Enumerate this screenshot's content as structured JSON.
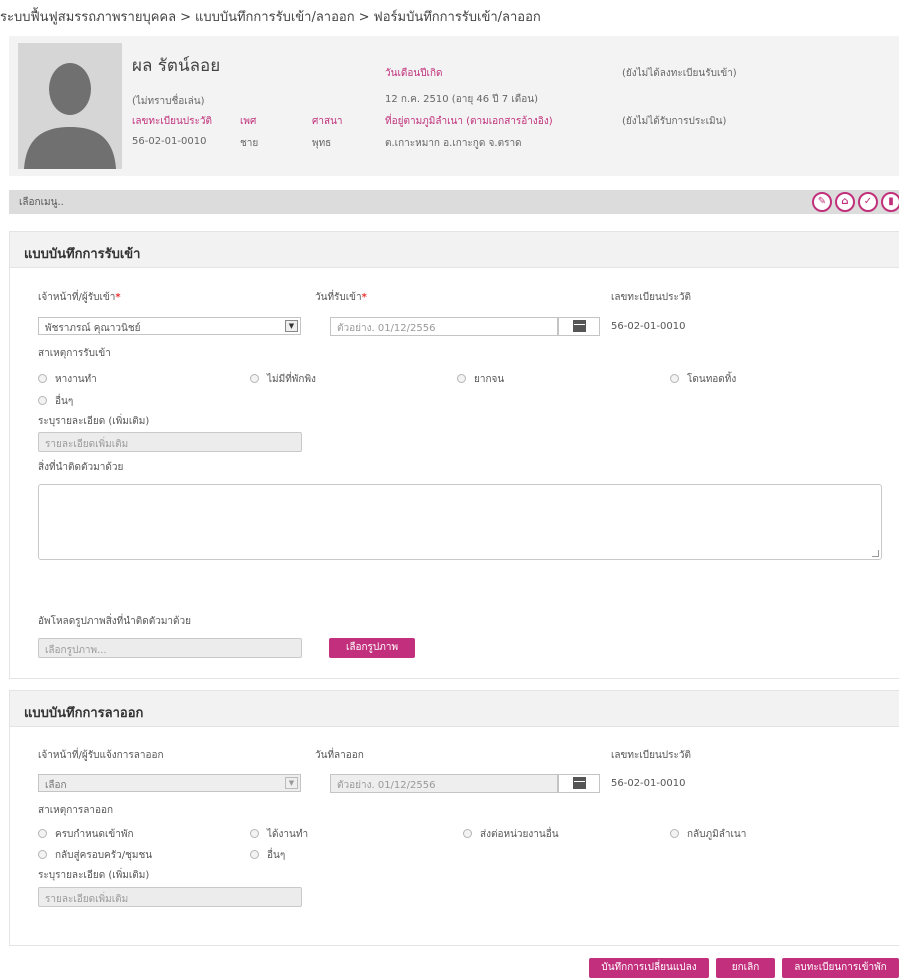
{
  "breadcrumb": [
    "ระบบฟื้นฟูสมรรถภาพรายบุคคล",
    "แบบบันทึกการรับเข้า/ลาออก",
    "ฟอร์มบันทึกการรับเข้า/ลาออก"
  ],
  "breadcrumb_sep": ">",
  "profile": {
    "name": "ผล รัตน์ลอย",
    "nickname": "(ไม่ทราบชื่อเล่น)",
    "reg_label": "เลขทะเบียนประวัติ",
    "reg_value": "56-02-01-0010",
    "sex_label": "เพศ",
    "sex_value": "ชาย",
    "religion_label": "ศาสนา",
    "religion_value": "พุทธ",
    "dob_label": "วันเดือนปีเกิด",
    "dob_value": "12 ก.ค. 2510 (อายุ 46 ปี 7 เดือน)",
    "address_label": "ที่อยู่ตามภูมิลำเนา (ตามเอกสารอ้างอิง)",
    "address_value": "ต.เกาะหมาก อ.เกาะกูด จ.ตราด",
    "status_admit": "(ยังไม่ได้ลงทะเบียนรับเข้า)",
    "status_eval": "(ยังไม่ได้รับการประเมิน)"
  },
  "menu": {
    "label": "เลือกเมนู..",
    "icons": [
      "edit-icon",
      "home-icon",
      "check-icon",
      "delete-icon"
    ]
  },
  "admission": {
    "title": "แบบบันทึกการรับเข้า",
    "officer_label": "เจ้าหน้าที่/ผู้รับเข้า",
    "officer_value": "พัชราภรณ์ คุณาวนิชย์",
    "date_label": "วันที่รับเข้า",
    "date_placeholder": "ตัวอย่าง. 01/12/2556",
    "reg_label": "เลขทะเบียนประวัติ",
    "reg_value": "56-02-01-0010",
    "reason_label": "สาเหตุการรับเข้า",
    "reasons": [
      "หางานทำ",
      "ไม่มีที่พักพิง",
      "ยากจน",
      "โดนทอดทิ้ง",
      "อื่นๆ"
    ],
    "detail_label": "ระบุรายละเอียด (เพิ่มเติม)",
    "detail_placeholder": "รายละเอียดเพิ่มเติม",
    "belongings_label": "สิ่งที่นำติดตัวมาด้วย",
    "upload_label": "อัพโหลดรูปภาพสิ่งที่นำติดตัวมาด้วย",
    "upload_placeholder": "เลือกรูปภาพ...",
    "upload_button": "เลือกรูปภาพ"
  },
  "discharge": {
    "title": "แบบบันทึกการลาออก",
    "officer_label": "เจ้าหน้าที่/ผู้รับแจ้งการลาออก",
    "officer_value": "เลือก",
    "date_label": "วันที่ลาออก",
    "date_placeholder": "ตัวอย่าง. 01/12/2556",
    "reg_label": "เลขทะเบียนประวัติ",
    "reg_value": "56-02-01-0010",
    "reason_label": "สาเหตุการลาออก",
    "reasons": [
      "ครบกำหนดเข้าพัก",
      "ได้งานทำ",
      "ส่งต่อหน่วยงานอื่น",
      "กลับภูมิลำเนา",
      "กลับสู่ครอบครัว/ชุมชน",
      "อื่นๆ"
    ],
    "detail_label": "ระบุรายละเอียด (เพิ่มเติม)",
    "detail_placeholder": "รายละเอียดเพิ่มเติม"
  },
  "footer": {
    "save": "บันทึกการเปลี่ยนแปลง",
    "cancel": "ยกเลิก",
    "delete": "ลบทะเบียนการเข้าพัก"
  },
  "colors": {
    "accent": "#c2307d",
    "required": "#e53935"
  }
}
